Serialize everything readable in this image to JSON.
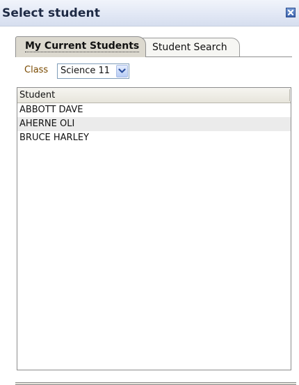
{
  "window": {
    "title": "Select student",
    "close_icon": "close-icon"
  },
  "tabs": [
    {
      "label": "My Current Students",
      "active": true
    },
    {
      "label": "Student Search",
      "active": false
    }
  ],
  "filter": {
    "class_label": "Class",
    "class_value": "Science 11"
  },
  "student_list": {
    "header": "Student",
    "rows": [
      "ABBOTT DAVE",
      "AHERNE OLI",
      "BRUCE HARLEY"
    ]
  },
  "colors": {
    "titlebar": "#e2e8f5",
    "tab_active": "#dcd9cf",
    "class_label": "#7a4a00",
    "row_alt": "#ebebeb"
  }
}
